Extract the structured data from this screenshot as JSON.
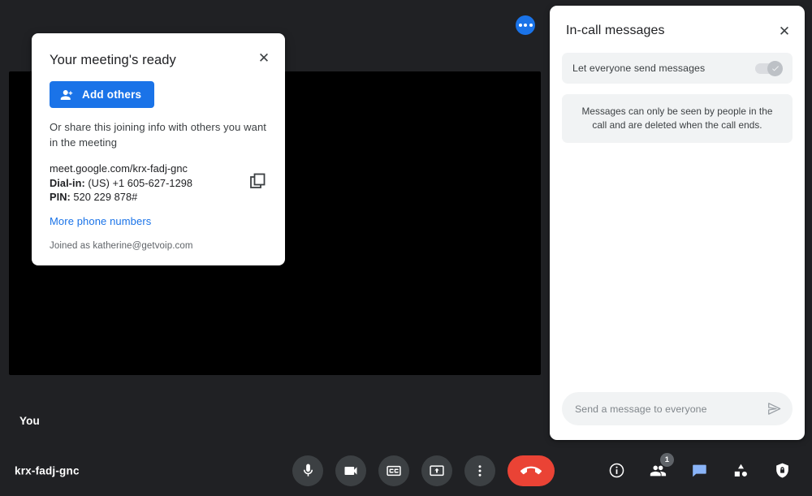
{
  "app": {
    "background_color": "#202124",
    "accent_blue": "#1a73e8",
    "danger_red": "#ea4335"
  },
  "stage": {
    "self_label": "You",
    "more_button_label": "more-options"
  },
  "meeting_dialog": {
    "title": "Your meeting's ready",
    "close_label": "✕",
    "add_others_label": "Add others",
    "share_text": "Or share this joining info with others you want in the meeting",
    "meet_link": "meet.google.com/krx-fadj-gnc",
    "dial_in_label": "Dial-in:",
    "dial_in_value": "(US) +1 605-627-1298",
    "pin_label": "PIN:",
    "pin_value": "520 229 878#",
    "more_phone_numbers": "More phone numbers",
    "joined_as": "Joined as katherine@getvoip.com"
  },
  "chat_panel": {
    "title": "In-call messages",
    "close_label": "✕",
    "let_everyone_send_label": "Let everyone send messages",
    "let_everyone_send_enabled": "on",
    "notice": "Messages can only be seen by people in the call and are deleted when the call ends.",
    "input_placeholder": "Send a message to everyone",
    "input_value": ""
  },
  "bottom_bar": {
    "meeting_code": "krx-fadj-gnc",
    "controls": [
      {
        "name": "microphone",
        "label": "Turn off microphone"
      },
      {
        "name": "camera",
        "label": "Turn off camera"
      },
      {
        "name": "captions",
        "label": "Turn on captions"
      },
      {
        "name": "present",
        "label": "Present now"
      },
      {
        "name": "more",
        "label": "More options"
      }
    ],
    "hangup_label": "Leave call",
    "right_controls": [
      {
        "name": "meeting-details",
        "label": "Meeting details"
      },
      {
        "name": "people",
        "label": "Show everyone",
        "badge": "1"
      },
      {
        "name": "chat",
        "label": "Chat with everyone",
        "active": "true"
      },
      {
        "name": "activities",
        "label": "Activities"
      },
      {
        "name": "host-controls",
        "label": "Host controls"
      }
    ]
  }
}
